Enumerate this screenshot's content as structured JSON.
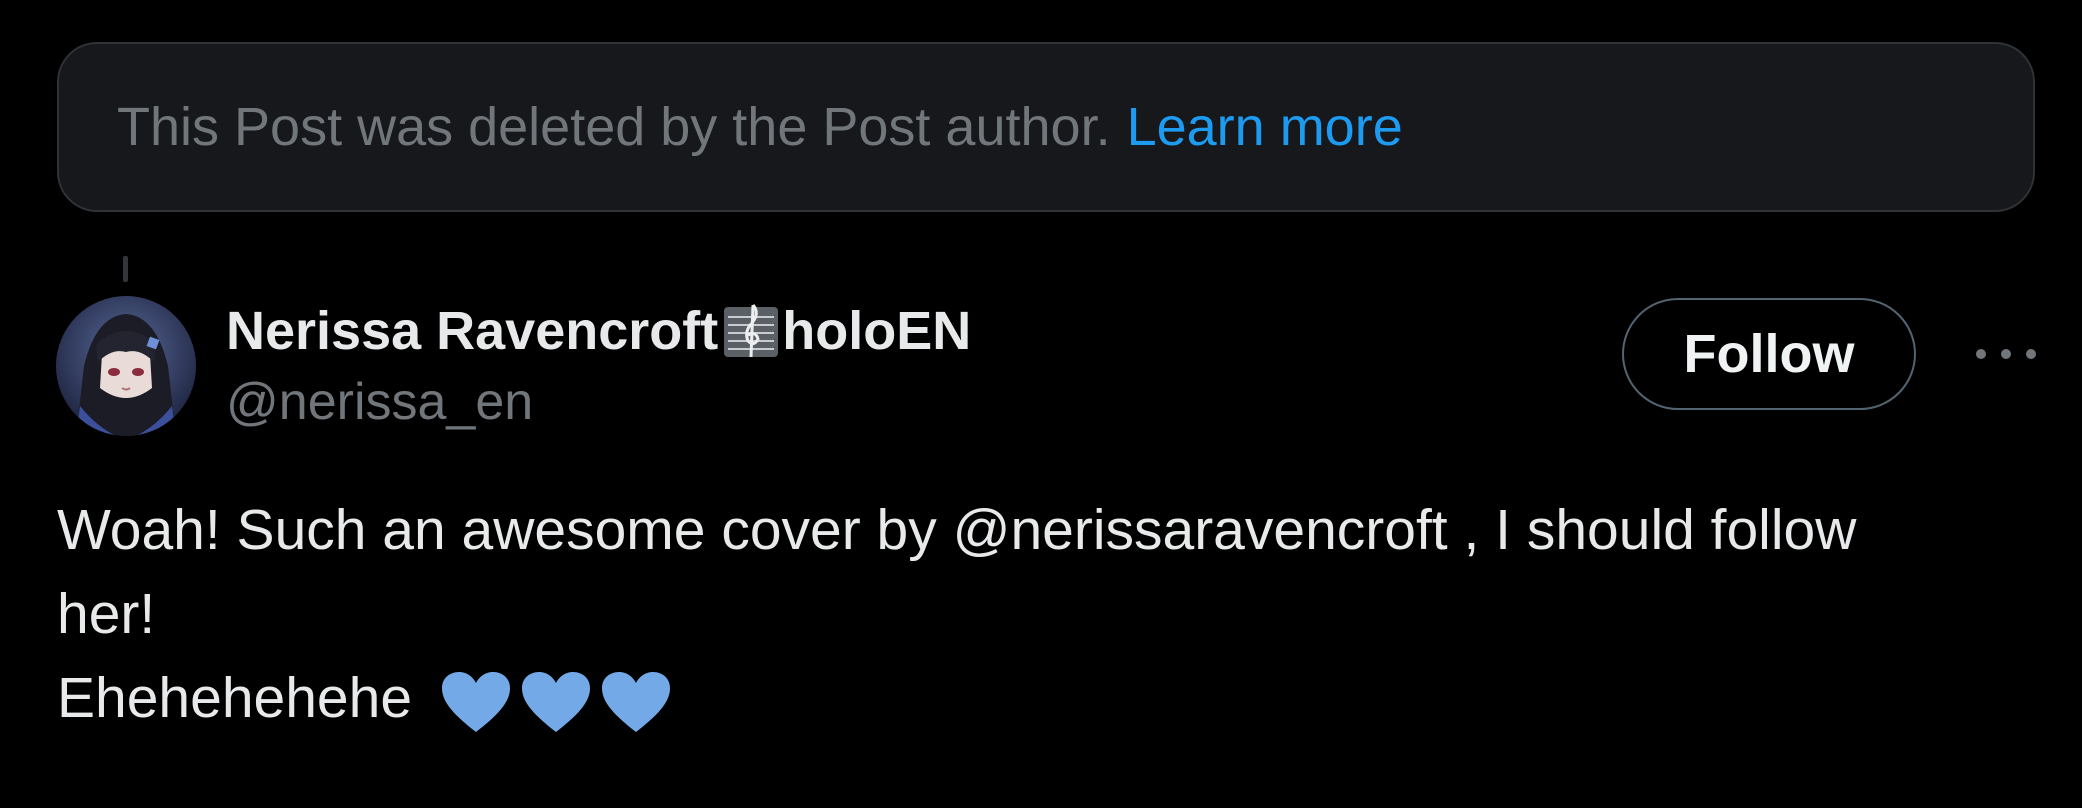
{
  "deleted_notice": {
    "text": "This Post was deleted by the Post author.",
    "link_label": "Learn more"
  },
  "post": {
    "author": {
      "name_part1": "Nerissa Ravencroft",
      "name_part2": "holoEN",
      "name_badge_icon": "treble-clef-staff-icon",
      "handle": "@nerissa_en",
      "avatar_icon": "avatar-anime-character"
    },
    "follow_label": "Follow",
    "more_icon": "more-options-icon",
    "text_line1_before": "Woah! Such an awesome cover by ",
    "mention": "@nerissaravencroft",
    "text_line1_after": " , I should follow",
    "text_line2": "her!",
    "text_line3": "Ehehehehehe",
    "hearts": [
      "blue-heart-icon",
      "blue-heart-icon",
      "blue-heart-icon"
    ]
  },
  "colors": {
    "background": "#000000",
    "notice_bg": "#16181c",
    "link": "#1d9bf0",
    "secondary_text": "#71767b",
    "primary_text": "#e7e9ea",
    "heart": "#74a9e8"
  }
}
